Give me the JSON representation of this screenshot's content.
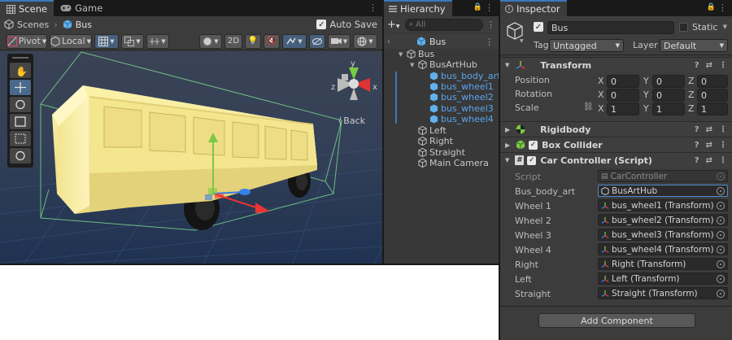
{
  "scene_tabs": [
    {
      "label": "Scene"
    },
    {
      "label": "Game"
    }
  ],
  "breadcrumb": {
    "root": "Scenes",
    "current": "Bus"
  },
  "auto_save": {
    "label": "Auto Save",
    "checked": true
  },
  "toolbar": {
    "pivot": "Pivot",
    "local": "Local",
    "mode_2d": "2D"
  },
  "gizmo": {
    "back_label": "Back",
    "axis_x": "x",
    "axis_y": "y",
    "axis_z": "z"
  },
  "hierarchy": {
    "title": "Hierarchy",
    "search_placeholder": "All",
    "items": [
      {
        "label": "Bus",
        "depth": 0
      },
      {
        "label": "BusArtHub",
        "depth": 1
      },
      {
        "label": "bus_body_art",
        "depth": 2
      },
      {
        "label": "bus_wheel1",
        "depth": 2
      },
      {
        "label": "bus_wheel2",
        "depth": 2
      },
      {
        "label": "bus_wheel3",
        "depth": 2
      },
      {
        "label": "bus_wheel4",
        "depth": 2
      },
      {
        "label": "Left",
        "depth": 1
      },
      {
        "label": "Right",
        "depth": 1
      },
      {
        "label": "Straight",
        "depth": 1
      },
      {
        "label": "Main Camera",
        "depth": 1
      }
    ]
  },
  "inspector": {
    "title": "Inspector",
    "object_name": "Bus",
    "static_label": "Static",
    "tag_label": "Tag",
    "tag_value": "Untagged",
    "layer_label": "Layer",
    "layer_value": "Default",
    "transform": {
      "title": "Transform",
      "rows": [
        {
          "label": "Position",
          "x": "0",
          "y": "0",
          "z": "0"
        },
        {
          "label": "Rotation",
          "x": "0",
          "y": "0",
          "z": "0"
        },
        {
          "label": "Scale",
          "x": "1",
          "y": "1",
          "z": "1"
        }
      ],
      "axis_x": "X",
      "axis_y": "Y",
      "axis_z": "Z"
    },
    "rigidbody": {
      "title": "Rigidbody"
    },
    "box_collider": {
      "title": "Box Collider"
    },
    "car_controller": {
      "title": "Car Controller (Script)",
      "script_label": "Script",
      "script_value": "CarController",
      "fields": [
        {
          "label": "Bus_body_art",
          "value": "BusArtHub"
        },
        {
          "label": "Wheel 1",
          "value": "bus_wheel1 (Transform)"
        },
        {
          "label": "Wheel 2",
          "value": "bus_wheel2 (Transform)"
        },
        {
          "label": "Wheel 3",
          "value": "bus_wheel3 (Transform)"
        },
        {
          "label": "Wheel 4",
          "value": "bus_wheel4 (Transform)"
        },
        {
          "label": "Right",
          "value": "Right (Transform)"
        },
        {
          "label": "Left",
          "value": "Left (Transform)"
        },
        {
          "label": "Straight",
          "value": "Straight (Transform)"
        }
      ]
    },
    "add_component": "Add Component"
  },
  "colors": {
    "accent": "#3a79bb",
    "selection_blue": "#5aa4f0",
    "bus_yellow": "#f5e99a",
    "scene_bg": "#28354a"
  }
}
